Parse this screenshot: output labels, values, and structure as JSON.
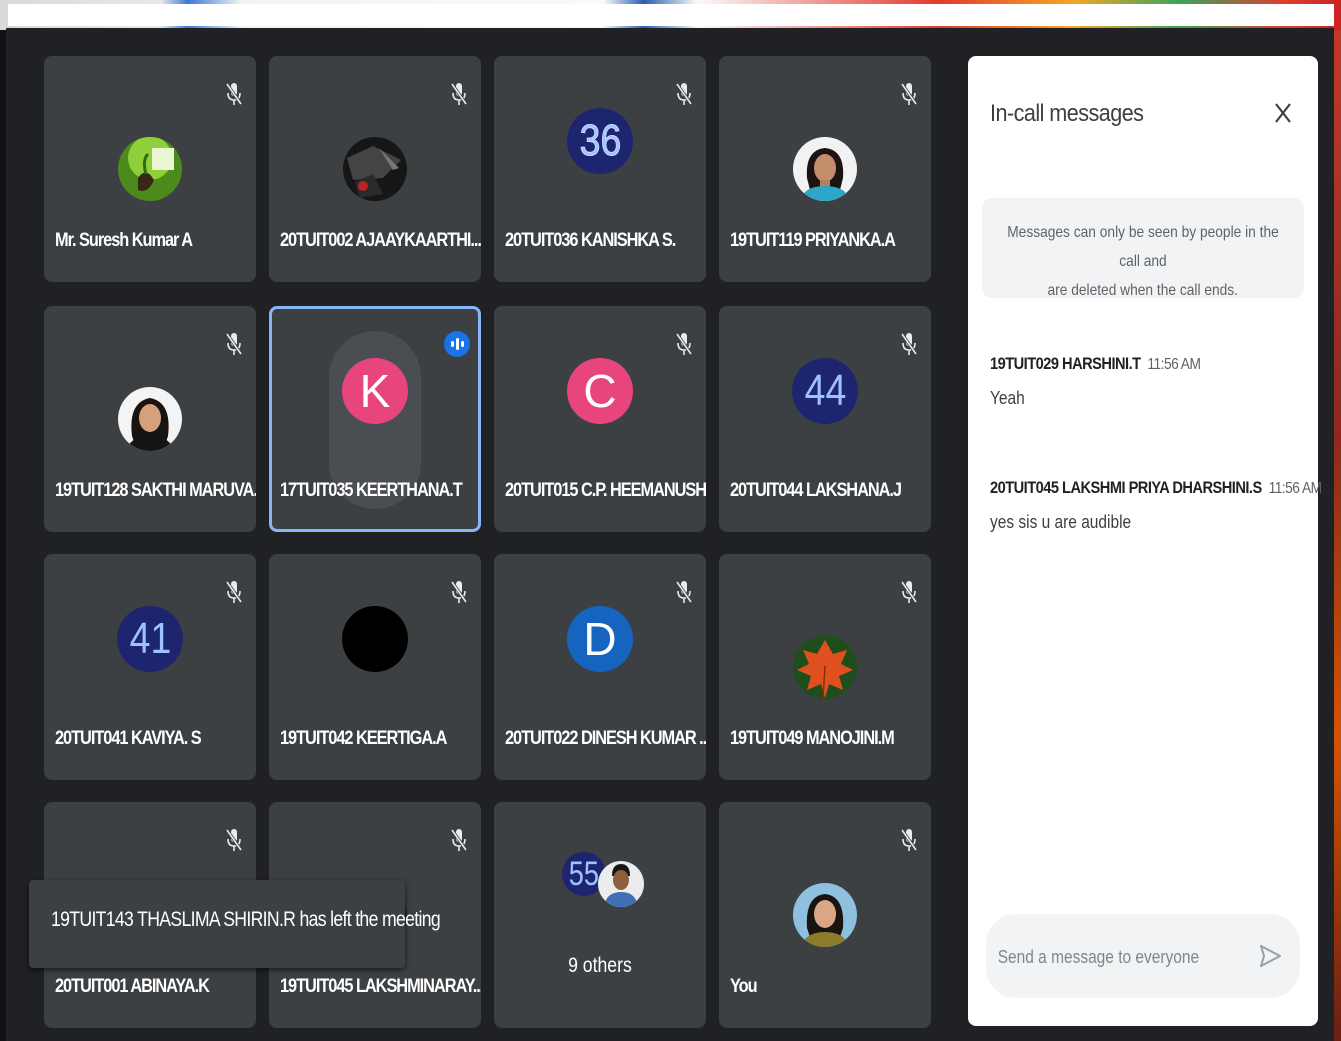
{
  "participants": [
    {
      "name": "Mr. Suresh Kumar A",
      "avatar": "photo-plant",
      "muted": true
    },
    {
      "name": "20TUIT002 AJAAYKAARTHI...",
      "avatar": "photo-dark",
      "muted": true
    },
    {
      "name": "20TUIT036 KANISHKA S.",
      "avatar": "36",
      "muted": true
    },
    {
      "name": "19TUIT119 PRIYANKA.A",
      "avatar": "photo-woman",
      "muted": true
    },
    {
      "name": "19TUIT128 SAKTHI MARUVA...",
      "avatar": "photo-woman",
      "muted": true
    },
    {
      "name": "17TUIT035 KEERTHANA.T",
      "avatar": "K",
      "muted": false,
      "speaking": true
    },
    {
      "name": "20TUIT015 C.P. HEEMANUSH",
      "avatar": "C",
      "muted": true
    },
    {
      "name": "20TUIT044 LAKSHANA.J",
      "avatar": "44",
      "muted": true
    },
    {
      "name": "20TUIT041 KAVIYA. S",
      "avatar": "41",
      "muted": true
    },
    {
      "name": "19TUIT042 KEERTIGA.A",
      "avatar": "black-circle",
      "muted": true
    },
    {
      "name": "20TUIT022 DINESH KUMAR ...",
      "avatar": "D",
      "muted": true
    },
    {
      "name": "19TUIT049 MANOJINI.M",
      "avatar": "photo-leaf",
      "muted": true
    },
    {
      "name": "20TUIT001 ABINAYA.K",
      "avatar": "photo-purple",
      "muted": true
    },
    {
      "name": "19TUIT045 LAKSHMINARAY...",
      "avatar": "photo-dark",
      "muted": true
    },
    {
      "name": "9 others",
      "avatar": "55 + photo",
      "muted": false
    },
    {
      "name": "You",
      "avatar": "photo-woman",
      "muted": true
    }
  ],
  "colors": {
    "pink": "#e8457d",
    "navy": "#1d2470",
    "blue": "#1565c0",
    "tile": "#3c4043",
    "speaking_border": "#8ab4f8"
  },
  "panel": {
    "title": "In-call messages",
    "notice_line1": "Messages can only be seen by people in the call and",
    "notice_line2": "are deleted when the call ends.",
    "messages": [
      {
        "sender": "19TUIT029 HARSHINI.T",
        "time": "11:56 AM",
        "text": "Yeah"
      },
      {
        "sender": "20TUIT045 LAKSHMI PRIYA DHARSHINI.S",
        "time": "11:56 AM",
        "text": "yes sis u are audible"
      }
    ],
    "input_placeholder": "Send a message to everyone"
  },
  "toast": "19TUIT143 THASLIMA SHIRIN.R has left the meeting"
}
